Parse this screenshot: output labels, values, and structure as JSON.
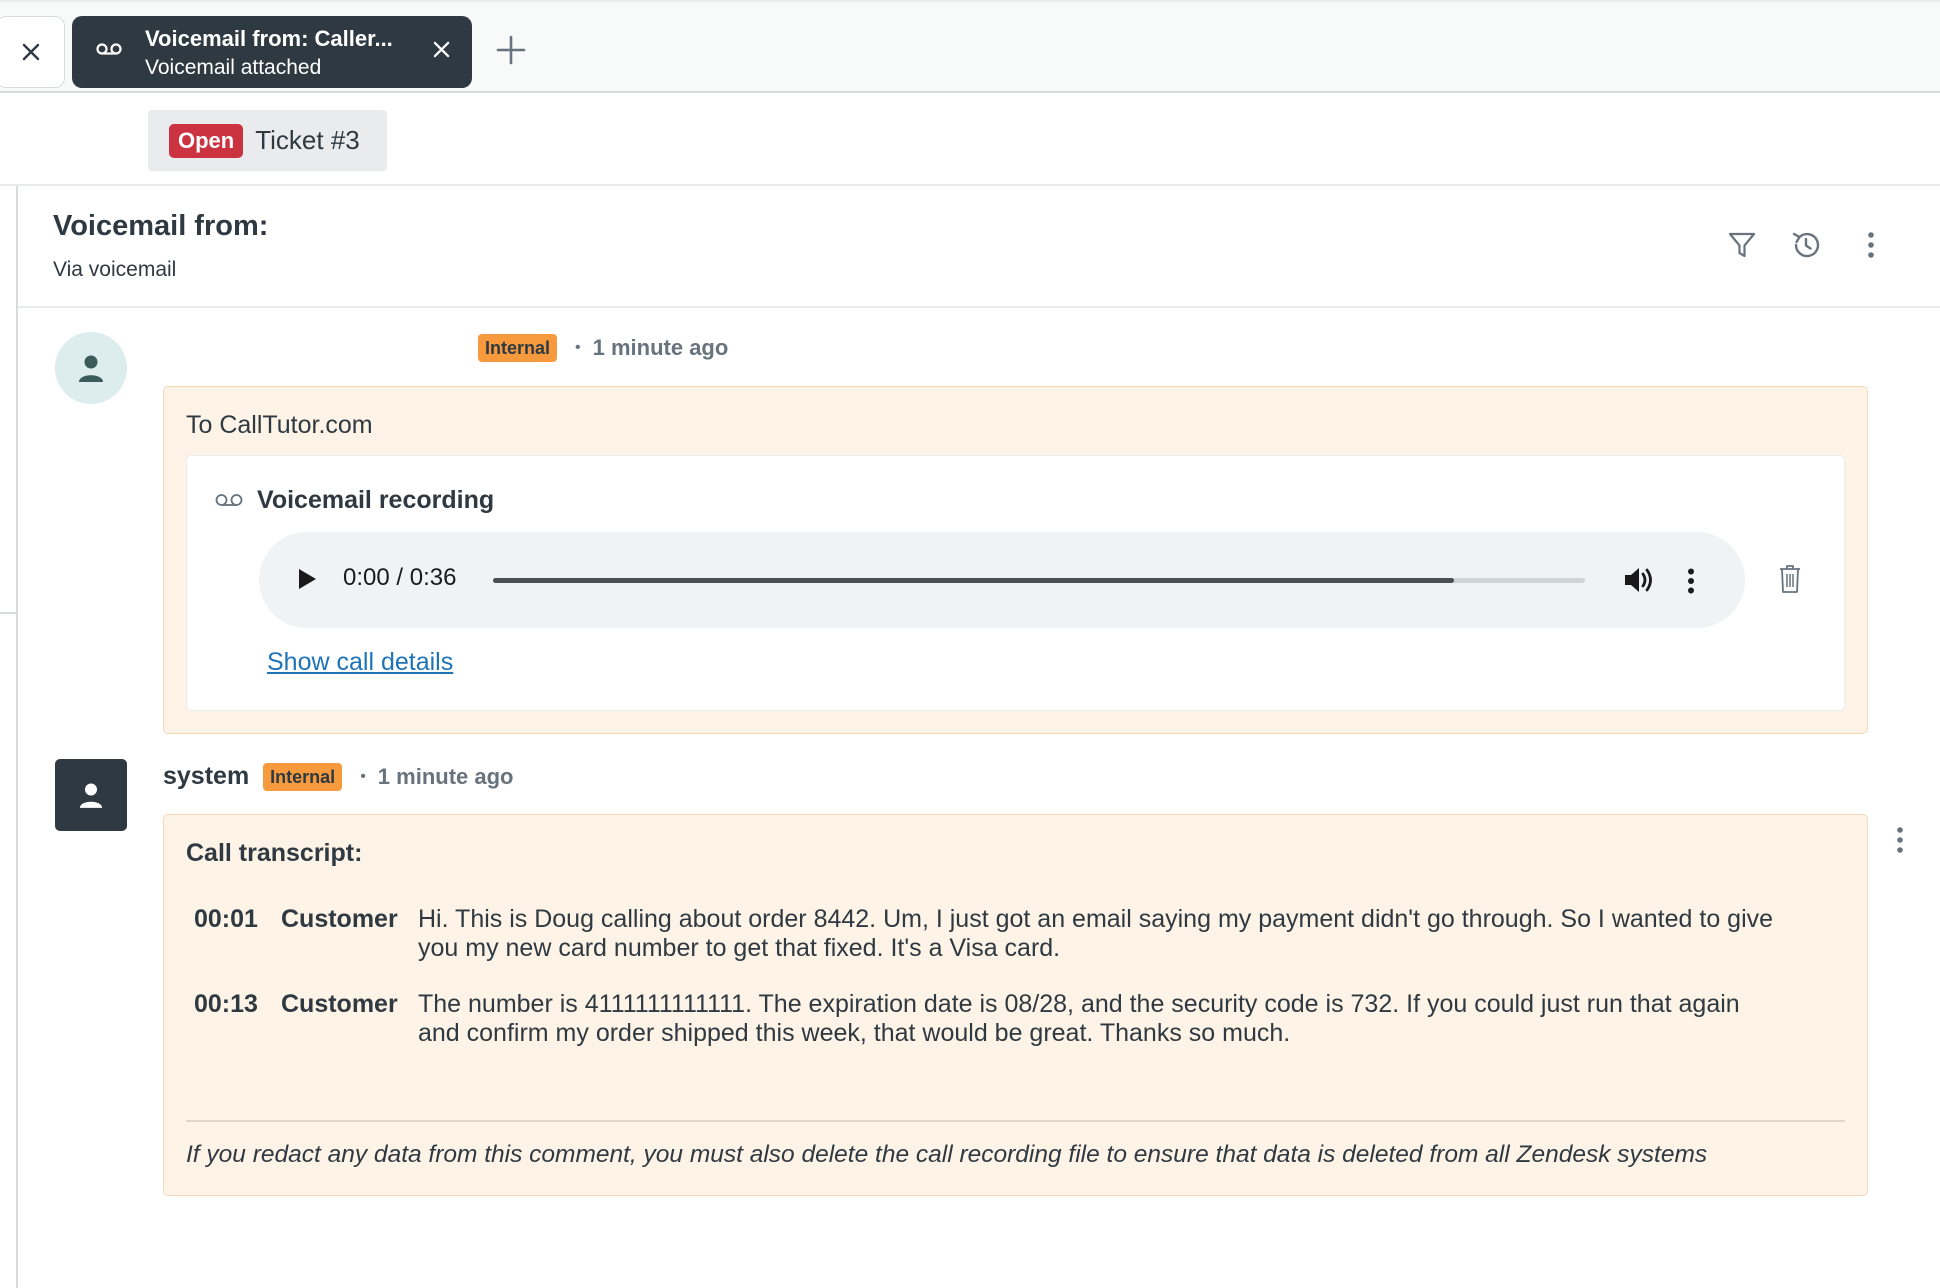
{
  "tabs": {
    "close_tab_icon": "close-icon",
    "active": {
      "icon": "voicemail-icon",
      "title": "Voicemail from: Caller...",
      "subtitle": "Voicemail attached",
      "close_icon": "close-icon"
    },
    "add_tab_icon": "plus-icon"
  },
  "ticket": {
    "status": "Open",
    "status_color": "#cc3340",
    "number": "Ticket #3"
  },
  "conversation": {
    "title": "Voicemail from:",
    "subtitle": "Via voicemail",
    "actions": [
      "filter-icon",
      "history-icon",
      "more-vertical-icon"
    ]
  },
  "comments": [
    {
      "author": "",
      "badge": "Internal",
      "time": "1 minute ago",
      "to": "To CallTutor.com",
      "recording": {
        "title": "Voicemail recording",
        "time_display": "0:00 / 0:36",
        "buffered_fraction": 0.88,
        "link": "Show call details"
      }
    },
    {
      "author": "system",
      "badge": "Internal",
      "time": "1 minute ago",
      "transcript_title": "Call transcript:",
      "lines": [
        {
          "time": "00:01",
          "speaker": "Customer",
          "text": "Hi. This is Doug calling about order 8442. Um, I just got an email saying my payment didn't go through. So I wanted to give you my new card number to get that fixed. It's a Visa card."
        },
        {
          "time": "00:13",
          "speaker": "Customer",
          "text": "The number is 4111111111111. The expiration date is 08/28, and the security code is 732. If you could just run that again and confirm my order shipped this week, that would be great. Thanks so much."
        }
      ],
      "note": "If you redact any data from this comment, you must also delete the call recording file to ensure that data is deleted from all Zendesk systems"
    }
  ],
  "colors": {
    "accent_dark": "#2f3941",
    "internal_badge": "#f79a3e",
    "internal_bg": "#fdf3e6",
    "link": "#1f73b7"
  }
}
